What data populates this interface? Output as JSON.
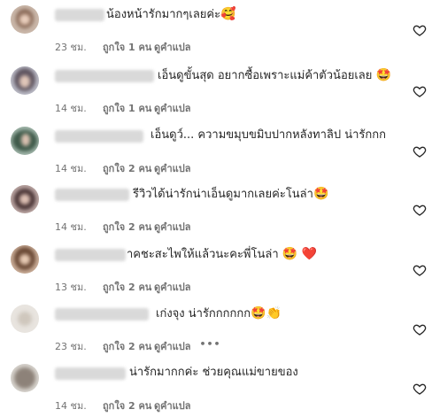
{
  "comments": [
    {
      "username": "mebo_li",
      "text": "น้องหน้ารักมากๆเลยค่ะ",
      "emoji": "🥰",
      "time": "23 ชม.",
      "likes": "ถูกใจ 1 คน",
      "translate": "ดูคำแปล",
      "more": ""
    },
    {
      "username": "phachi_buyboy",
      "text": "เอ็นดูขั้นสุด อยากซื้อเพราะแม่ค้าตัวน้อยเลย",
      "emoji": "🤩",
      "time": "14 ชม.",
      "likes": "ถูกใจ 1 คน",
      "translate": "ดูคำแปล",
      "more": ""
    },
    {
      "username": "snow_tipparat",
      "text": "เอ็นดูว์... ความขมุบขมิบปากหลังทาลิป น่ารักกก",
      "emoji": "",
      "time": "14 ชม.",
      "likes": "ถูกใจ 2 คน",
      "translate": "ดูคำแปล",
      "more": ""
    },
    {
      "username": "ladlyhongggg",
      "text": "รีวิวได้น่ารักน่าเอ็นดูมากเลยค่ะโนล่า",
      "emoji": "🤩",
      "time": "14 ชม.",
      "likes": "ถูกใจ 2 คน",
      "translate": "ดูคำแปล",
      "more": ""
    },
    {
      "username": "michaugh",
      "text": "าคชะสะไพให้แล้วนะคะพี่โนล่า",
      "emoji": "🤩 ❤️",
      "time": "13 ชม.",
      "likes": "ถูกใจ 2 คน",
      "translate": "ดูคำแปล",
      "more": ""
    },
    {
      "username": "nanthatanalley",
      "text": "เก่งจุง น่ารักกกกกก",
      "emoji": "🤩👏",
      "time": "23 ชม.",
      "likes": "ถูกใจ 2 คน",
      "translate": "ดูคำแปล",
      "more": "•••"
    },
    {
      "username": "aoy_aum_1",
      "text": "น่ารักมากกค่ะ ช่วยคุณแม่ขายของ",
      "emoji": "",
      "time": "14 ชม.",
      "likes": "ถูกใจ 2 คน",
      "translate": "ดูคำแปล",
      "more": ""
    }
  ]
}
